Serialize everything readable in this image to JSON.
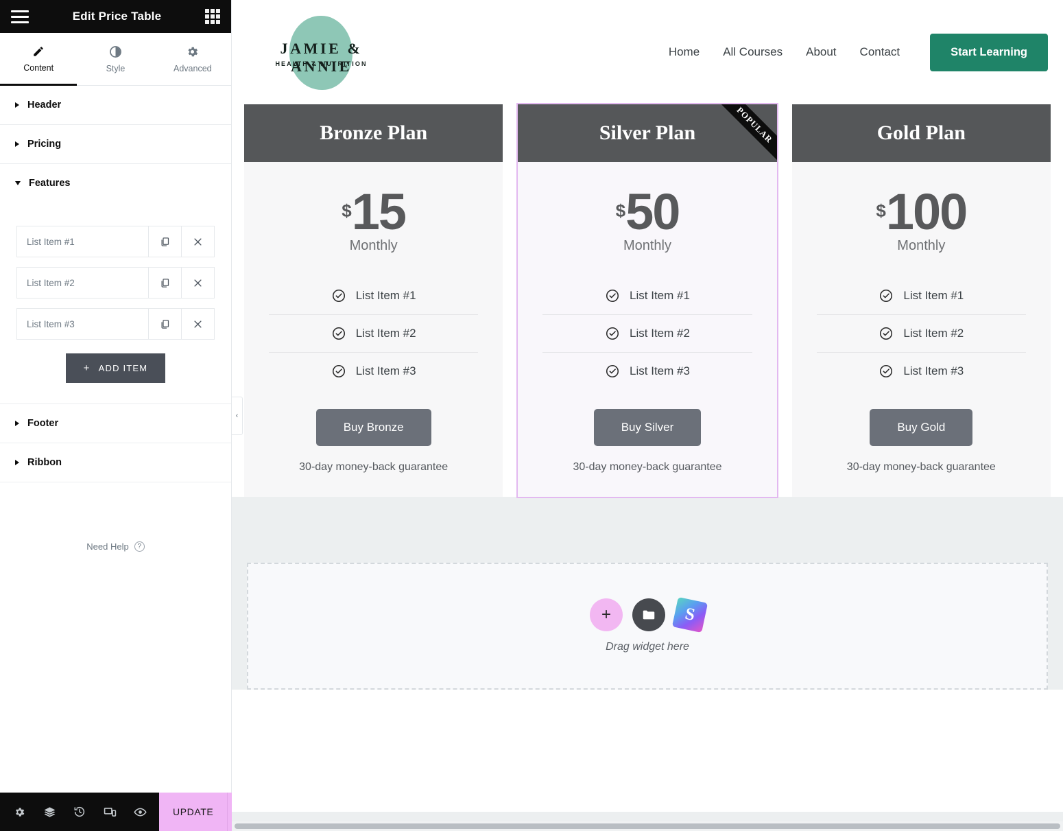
{
  "panel": {
    "title": "Edit Price Table",
    "menu_icon": "hamburger-icon",
    "grid_icon": "widgets-grid-icon",
    "tabs": [
      {
        "label": "Content",
        "icon": "pencil-icon",
        "active": true
      },
      {
        "label": "Style",
        "icon": "contrast-icon",
        "active": false
      },
      {
        "label": "Advanced",
        "icon": "gear-icon",
        "active": false
      }
    ],
    "sections": [
      {
        "label": "Header",
        "expanded": false
      },
      {
        "label": "Pricing",
        "expanded": false
      },
      {
        "label": "Features",
        "expanded": true
      },
      {
        "label": "Footer",
        "expanded": false
      },
      {
        "label": "Ribbon",
        "expanded": false
      }
    ],
    "features_items": [
      {
        "text": "List Item #1",
        "duplicate_icon": "copy-icon",
        "remove_icon": "close-icon"
      },
      {
        "text": "List Item #2",
        "duplicate_icon": "copy-icon",
        "remove_icon": "close-icon"
      },
      {
        "text": "List Item #3",
        "duplicate_icon": "copy-icon",
        "remove_icon": "close-icon"
      }
    ],
    "add_item_label": "ADD ITEM",
    "add_item_plus": "+",
    "need_help": "Need Help",
    "footer": {
      "icons": [
        "settings-gear-icon",
        "navigator-layers-icon",
        "history-clock-icon",
        "responsive-devices-icon",
        "preview-eye-icon"
      ],
      "update_label": "UPDATE",
      "update_caret_icon": "chevron-up-icon"
    },
    "collapse_icon": "chevron-left-icon"
  },
  "site": {
    "logo": {
      "name": "JAMIE & ANNIE",
      "tagline": "HEALTH & NUTRITION",
      "blob_color": "#8ec7b6"
    },
    "nav": [
      "Home",
      "All Courses",
      "About",
      "Contact"
    ],
    "cta": {
      "label": "Start Learning",
      "color": "#1f8468"
    }
  },
  "plans": [
    {
      "title": "Bronze Plan",
      "currency": "$",
      "amount": "15",
      "period": "Monthly",
      "features": [
        "List Item #1",
        "List Item #2",
        "List Item #3"
      ],
      "button": "Buy Bronze",
      "guarantee": "30-day money-back guarantee",
      "ribbon": "",
      "selected": false
    },
    {
      "title": "Silver Plan",
      "currency": "$",
      "amount": "50",
      "period": "Monthly",
      "features": [
        "List Item #1",
        "List Item #2",
        "List Item #3"
      ],
      "button": "Buy Silver",
      "guarantee": "30-day money-back guarantee",
      "ribbon": "POPULAR",
      "selected": true
    },
    {
      "title": "Gold Plan",
      "currency": "$",
      "amount": "100",
      "period": "Monthly",
      "features": [
        "List Item #1",
        "List Item #2",
        "List Item #3"
      ],
      "button": "Buy Gold",
      "guarantee": "30-day money-back guarantee",
      "ribbon": "",
      "selected": false
    }
  ],
  "dropzone": {
    "label": "Drag widget here",
    "add_icon": "plus-icon",
    "folder_icon": "folder-icon",
    "stock_icon": "stock-images-icon",
    "add_glyph": "+",
    "stock_glyph": "S"
  },
  "colors": {
    "panel_header_bg": "#0d0d0d",
    "update_bg": "#f0b5f5",
    "selection_border": "#e3b9f0",
    "plan_head_bg": "#555759",
    "buy_bg": "#6b7079",
    "canvas_bg": "#eceff0"
  }
}
